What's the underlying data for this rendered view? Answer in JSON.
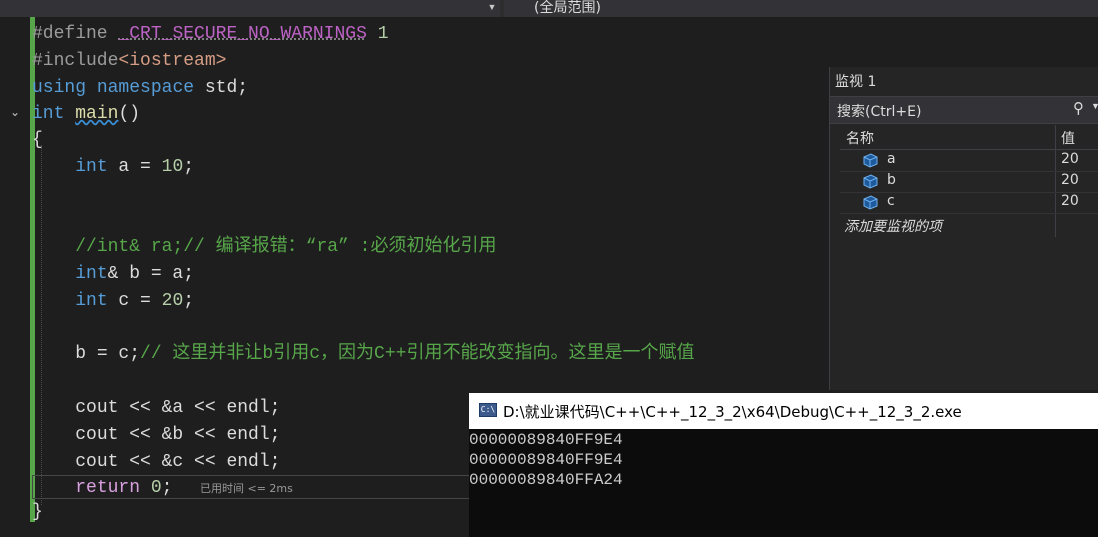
{
  "scope_selector": {
    "label": "(全局范围)"
  },
  "editor": {
    "line1": {
      "directive": "#define",
      "macro": "_CRT_SECURE_NO_WARNINGS",
      "value": "1"
    },
    "line2": {
      "directive": "#include",
      "header": "<iostream>"
    },
    "line3": {
      "kw1": "using",
      "kw2": "namespace",
      "ident": "std;"
    },
    "line4": {
      "type": "int",
      "name": "main",
      "parens": "()"
    },
    "line5": {
      "text": "{"
    },
    "line6": {
      "type": "int",
      "rest": " a = ",
      "num": "10",
      "end": ";"
    },
    "line9": {
      "comment": "//int& ra;// 编译报错：“ra” :必须初始化引用"
    },
    "line10": {
      "type": "int",
      "rest": "& b = a;"
    },
    "line11": {
      "type": "int",
      "rest": " c = ",
      "num": "20",
      "end": ";"
    },
    "line13": {
      "code": "b = c;",
      "comment": "// 这里并非让b引用c，因为C++引用不能改变指向。这里是一个赋值"
    },
    "line15": {
      "code": "cout << &a << endl;"
    },
    "line16": {
      "code": "cout << &b << endl;"
    },
    "line17": {
      "code": "cout << &c << endl;"
    },
    "line18": {
      "kw": "return",
      "num": "0",
      "end": ";"
    },
    "line19": {
      "text": "}"
    },
    "perf_hint": "已用时间 <= 2ms"
  },
  "watch": {
    "title": "监视 1",
    "search_placeholder": "搜索(Ctrl+E)",
    "col_name": "名称",
    "col_value": "值",
    "rows": [
      {
        "name": "a",
        "value": "20"
      },
      {
        "name": "b",
        "value": "20"
      },
      {
        "name": "c",
        "value": "20"
      }
    ],
    "add_item": "添加要监视的项",
    "search_icon": "search-icon"
  },
  "console": {
    "icon_label": "C:\\",
    "title": "D:\\就业课代码\\C++\\C++_12_3_2\\x64\\Debug\\C++_12_3_2.exe",
    "lines": [
      "00000089840FF9E4",
      "00000089840FF9E4",
      "00000089840FFA24"
    ]
  },
  "colors": {
    "keyword": "#569cd6",
    "comment": "#57a64a",
    "number": "#b5cea8",
    "function": "#dcdcaa",
    "change_bar": "#57a64a"
  }
}
